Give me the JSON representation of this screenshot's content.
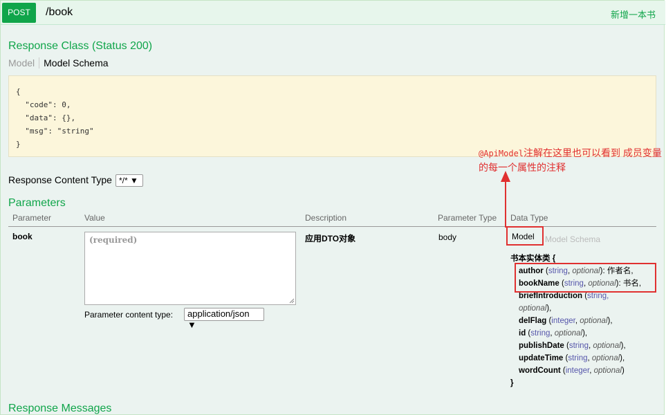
{
  "operation": {
    "method": "POST",
    "path": "/book",
    "summary": "新增一本书"
  },
  "response_class": {
    "heading": "Response Class (Status 200)",
    "tabs": [
      "Model",
      "Model Schema"
    ],
    "code_lines": [
      "{",
      "  \"code\": 0,",
      "  \"data\": {},",
      "  \"msg\": \"string\"",
      "}"
    ]
  },
  "response_content_type": {
    "label": "Response Content Type",
    "value": "*/*"
  },
  "parameters": {
    "heading": "Parameters",
    "headers": [
      "Parameter",
      "Value",
      "Description",
      "Parameter Type",
      "Data Type"
    ],
    "row": {
      "name": "book",
      "placeholder": "(required)",
      "content_type_label": "Parameter content type:",
      "content_type_value": "application/json",
      "description": "应用DTO对象",
      "param_type": "body"
    },
    "data_type_tabs": [
      "Model",
      "Model Schema"
    ],
    "model": {
      "title": "书本实体类 {",
      "close": "}",
      "properties": [
        {
          "name": "author",
          "type": "string",
          "opt": "optional",
          "desc": ": 作者名,"
        },
        {
          "name": "bookName",
          "type": "string",
          "opt": "optional",
          "desc": ": 书名,"
        },
        {
          "name": "briefIntroduction",
          "type": "string,",
          "opt": "optional",
          "desc": "),"
        },
        {
          "name": "delFlag",
          "type": "integer",
          "opt": "optional",
          "desc": "),"
        },
        {
          "name": "id",
          "type": "string",
          "opt": "optional",
          "desc": "),"
        },
        {
          "name": "publishDate",
          "type": "string",
          "opt": "optional",
          "desc": "),"
        },
        {
          "name": "updateTime",
          "type": "string",
          "opt": "optional",
          "desc": "),"
        },
        {
          "name": "wordCount",
          "type": "integer",
          "opt": "optional",
          "desc": ")"
        }
      ]
    }
  },
  "annotation": {
    "code_part": "@ApiModel",
    "text_part": "注解在这里也可以看到 成员变量的每一个属性的注释"
  },
  "cutoff_heading": "Response Messages",
  "colors": {
    "accent": "#10a54a",
    "highlight": "#e03030",
    "code_bg": "#fcf6db"
  }
}
